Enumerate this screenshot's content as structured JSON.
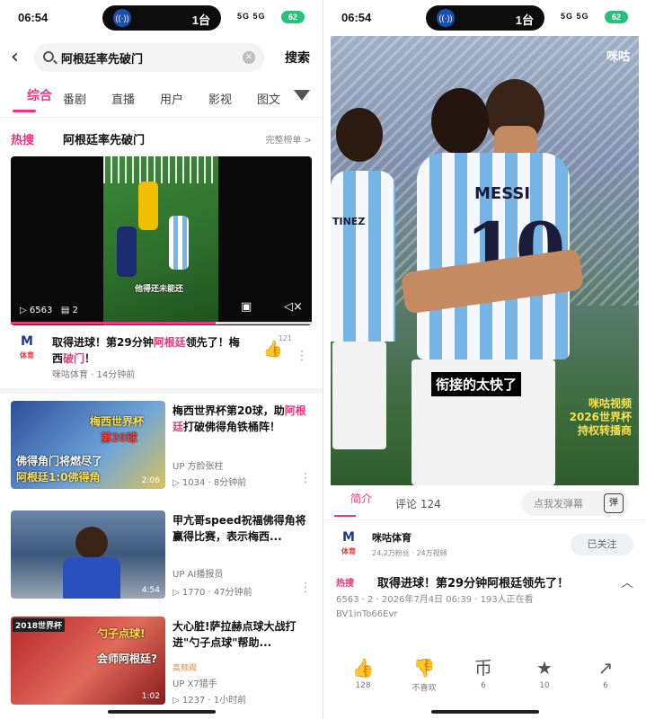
{
  "status": {
    "time": "06:54",
    "count": "1台",
    "signal": "5G 5G",
    "battery": "62"
  },
  "search": {
    "query": "阿根廷率先破门",
    "button": "搜索"
  },
  "tabs": [
    "综合",
    "番剧",
    "直播",
    "用户",
    "影视",
    "图文"
  ],
  "hot": {
    "label": "热搜",
    "title": "阿根廷率先破门",
    "more": "完整榜单 >"
  },
  "video1": {
    "caption": "他得还未能还",
    "plays": "6563",
    "comments": "2",
    "progress_ratio": 0.68,
    "title_pre": "取得进球！第29分钟",
    "title_hl": "阿根廷",
    "title_post": "领先了！梅西",
    "title_hl2": "破门",
    "title_end": "！",
    "source": "咪咕体育 · 14分钟前",
    "likes": "121",
    "avatar": "M",
    "avatar_sub": "体育"
  },
  "items": [
    {
      "title_pre": "梅西世界杯第20球，助",
      "title_hl": "阿根廷",
      "title_post": "打破佛得角铁桶阵！",
      "uploader": "方脸张柱",
      "stats": "1034 · 8分钟前",
      "duration": "2:06",
      "thumb_top": "梅西世界杯",
      "thumb_mid": "第20球",
      "thumb_b1": "佛得角门将燃尽了",
      "thumb_b2": "阿根廷1:0佛得角"
    },
    {
      "title_pre": "甲亢哥speed祝福佛得角将赢得比赛，表示梅西...",
      "title_hl": "",
      "title_post": "",
      "uploader": "AI播报员",
      "stats": "1770 · 47分钟前",
      "duration": "4:54"
    },
    {
      "title_pre": "大心脏!萨拉赫点球大战打进\"勺子点球\"帮助...",
      "title_hl": "",
      "title_post": "",
      "badge": "高频观",
      "uploader": "X7猎手",
      "stats": "1237 · 1小时前",
      "duration": "1:02",
      "thumb_top": "勺子点球!",
      "thumb_mid": "会师阿根廷?",
      "corner": "2018世界杯"
    }
  ],
  "player": {
    "brand": "咪咕",
    "shirt": "MESSI",
    "number": "10",
    "side": "TINEZ",
    "subtitle": "衔接的太快了",
    "watermark": [
      "咪咕视频",
      "2026世界杯",
      "持权转播商"
    ]
  },
  "detail": {
    "tabs": [
      "简介",
      "评论 124"
    ],
    "danmu_placeholder": "点我发弹幕",
    "danmu_btn": "弹",
    "channel": "咪咕体育",
    "channel_stats": "24.2万粉丝 · 24万视频",
    "follow": "已关注",
    "tag": "热搜",
    "title": "取得进球！第29分钟阿根廷领先了！",
    "meta_line1": "6563 · 2 · 2026年7月4日 06:39 · 193人正在看",
    "meta_line2": "BV1inTo66Evr",
    "actions": [
      {
        "icon": "👍",
        "label": "128"
      },
      {
        "icon": "👎",
        "label": "不喜欢"
      },
      {
        "icon": "币",
        "label": "6"
      },
      {
        "icon": "★",
        "label": "10"
      },
      {
        "icon": "↗",
        "label": "6"
      }
    ]
  },
  "colors": {
    "accent": "#f0367c"
  }
}
